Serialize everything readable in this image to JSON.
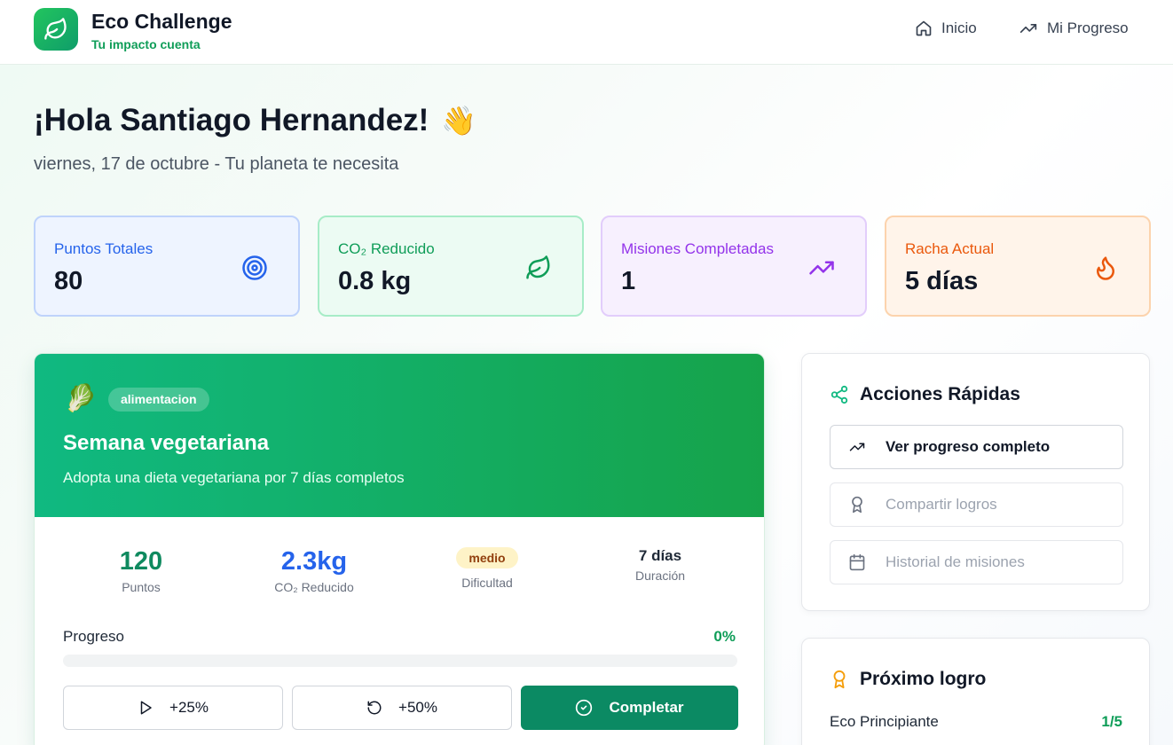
{
  "header": {
    "brand": "Eco Challenge",
    "tagline": "Tu impacto cuenta",
    "nav": [
      {
        "label": "Inicio",
        "icon": "home-icon"
      },
      {
        "label": "Mi Progreso",
        "icon": "trending-up-icon"
      }
    ]
  },
  "hero": {
    "greeting": "¡Hola Santiago Hernandez!",
    "emoji": "👋",
    "subtitle": "viernes, 17 de octubre - Tu planeta te necesita"
  },
  "stats": [
    {
      "label": "Puntos Totales",
      "value": "80",
      "icon": "target-icon",
      "color": "#2563eb",
      "bg": "#eef4ff",
      "border": "#bfd3fb"
    },
    {
      "label": "CO₂ Reducido",
      "value": "0.8 kg",
      "icon": "leaf-icon",
      "color": "#0f9d58",
      "bg": "#ecfbf3",
      "border": "#a7ecc7"
    },
    {
      "label": "Misiones Completadas",
      "value": "1",
      "icon": "trending-up-icon",
      "color": "#9333ea",
      "bg": "#f7f0fe",
      "border": "#e2cdfb"
    },
    {
      "label": "Racha Actual",
      "value": "5 días",
      "icon": "flame-icon",
      "color": "#ea580c",
      "bg": "#fff4ea",
      "border": "#fcd3ad"
    }
  ],
  "mission": {
    "emoji": "🥬",
    "category": "alimentacion",
    "title": "Semana vegetariana",
    "description": "Adopta una dieta vegetariana por 7 días completos",
    "points": {
      "value": "120",
      "label": "Puntos"
    },
    "co2": {
      "value": "2.3kg",
      "label": "CO₂ Reducido"
    },
    "difficulty": {
      "value": "medio",
      "label": "Dificultad"
    },
    "duration": {
      "value": "7 días",
      "label": "Duración"
    },
    "progress_label": "Progreso",
    "progress_text": "0%",
    "progress": 0,
    "buttons": {
      "quarter": "+25%",
      "half": "+50%",
      "complete": "Completar"
    }
  },
  "quick_actions": {
    "title": "Acciones Rápidas",
    "items": [
      {
        "label": "Ver progreso completo",
        "icon": "trending-up-icon"
      },
      {
        "label": "Compartir logros",
        "icon": "award-icon"
      },
      {
        "label": "Historial de misiones",
        "icon": "calendar-icon"
      }
    ]
  },
  "next_achievement": {
    "title": "Próximo logro",
    "name": "Eco Principiante",
    "count": "1/5"
  }
}
